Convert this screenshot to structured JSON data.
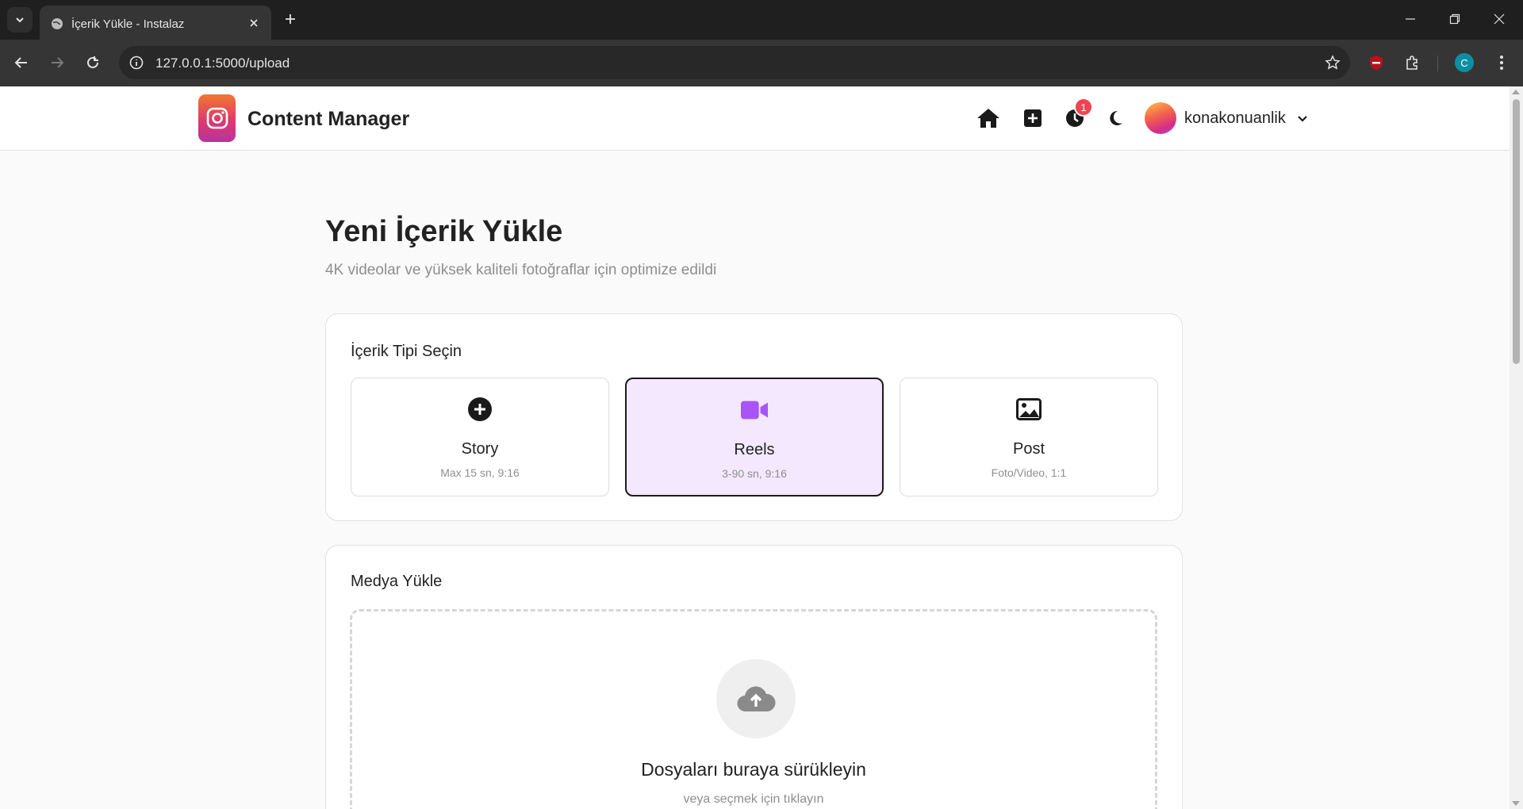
{
  "browser": {
    "tab_title": "İçerik Yükle - Instalaz",
    "url": "127.0.0.1:5000/upload",
    "profile_initial": "C"
  },
  "header": {
    "brand": "Content Manager",
    "notification_count": "1",
    "username": "konakonuanlik",
    "icons": [
      "home-icon",
      "plus-square-icon",
      "history-icon",
      "moon-icon",
      "chevron-down-icon"
    ]
  },
  "page": {
    "title": "Yeni İçerik Yükle",
    "subtitle": "4K videolar ve yüksek kaliteli fotoğraflar için optimize edildi"
  },
  "content_type": {
    "heading": "İçerik Tipi Seçin",
    "selected": "Reels",
    "options": [
      {
        "name": "Story",
        "desc": "Max 15 sn, 9:16",
        "icon": "plus-circle-icon"
      },
      {
        "name": "Reels",
        "desc": "3-90 sn, 9:16",
        "icon": "video-icon"
      },
      {
        "name": "Post",
        "desc": "Foto/Video, 1:1",
        "icon": "image-icon"
      }
    ]
  },
  "media": {
    "heading": "Medya Yükle",
    "drop_title": "Dosyaları buraya sürükleyin",
    "drop_sub": "veya seçmek için tıklayın",
    "icon": "cloud-upload-icon"
  },
  "colors": {
    "selected_bg": "#f3e8ff",
    "accent_purple": "#a855f7",
    "badge_red": "#ef4456"
  }
}
